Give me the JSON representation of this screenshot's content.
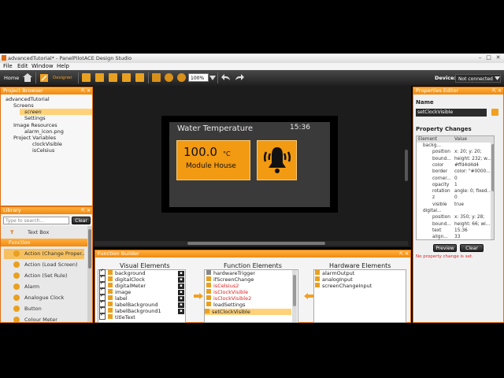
{
  "window": {
    "title": "advancedTutorial* - PanelPilotACE Design Studio"
  },
  "menu": {
    "file": "File",
    "edit": "Edit",
    "window": "Window",
    "help": "Help"
  },
  "toolbar": {
    "home": "Home",
    "designer": "Designer",
    "zoom": "100%",
    "device_label": "Device:",
    "device_value": "Not connected"
  },
  "project_browser": {
    "title": "Project Browser",
    "items": [
      "advancedTutorial",
      "Screens",
      "screen",
      "Settings",
      "Image Resources",
      "alarm_icon.png",
      "Project Variables",
      "clockVisible",
      "isCelsius"
    ]
  },
  "library": {
    "title": "Library",
    "search_placeholder": "Type to search...",
    "clear": "Clear",
    "top_item": "Text Box",
    "section": "Function",
    "items": [
      "Action (Change Proper...",
      "Action (Load Screen)",
      "Action (Set Rule)",
      "Alarm",
      "Analogue Clock",
      "Button",
      "Colour Meter"
    ]
  },
  "canvas": {
    "title": "Water Temperature",
    "clock": "15:36",
    "value": "100.0",
    "unit": "°C",
    "label": "Module House"
  },
  "function_builder": {
    "title": "Function Builder",
    "visual_elements_title": "Visual Elements",
    "visual_elements": [
      "background",
      "digitalClock",
      "digitalMeter",
      "image",
      "label",
      "labelBackground",
      "labelBackground1",
      "titleText"
    ],
    "function_elements_title": "Function Elements",
    "function_elements": [
      "hardwareTrigger",
      "ifScreenChange",
      "isCelsius2",
      "isClockVisible",
      "isClockVisible2",
      "loadSettings",
      "setClockVisible"
    ],
    "hardware_elements_title": "Hardware Elements",
    "hardware_elements": [
      "alarmOutput",
      "analogInput",
      "screenChangeInput"
    ]
  },
  "properties": {
    "title": "Properties Editor",
    "name_label": "Name",
    "name_value": "setClockVisible",
    "changes_title": "Property Changes",
    "col_element": "Element",
    "col_value": "Value",
    "rows": [
      {
        "k": "backg...",
        "v": ""
      },
      {
        "k": "position",
        "v": "x: 20; y: 20;"
      },
      {
        "k": "bound...",
        "v": "height: 232; w..."
      },
      {
        "k": "color",
        "v": "#ffd4d4d4"
      },
      {
        "k": "border",
        "v": "color: \"#0000..."
      },
      {
        "k": "corner...",
        "v": "0"
      },
      {
        "k": "opacity",
        "v": "1"
      },
      {
        "k": "rotation",
        "v": "angle: 0; fixed..."
      },
      {
        "k": "z",
        "v": "0"
      },
      {
        "k": "visible",
        "v": "true"
      },
      {
        "k": "digital...",
        "v": ""
      },
      {
        "k": "position",
        "v": "x: 350; y: 28;"
      },
      {
        "k": "bound...",
        "v": "height: 66; wi..."
      },
      {
        "k": "text",
        "v": "15:36"
      },
      {
        "k": "align...",
        "v": "33"
      }
    ],
    "preview": "Preview",
    "clear": "Clear",
    "status": "No property change is set."
  },
  "colors": {
    "accent": "#f29a12",
    "header": "#f08a10",
    "toolbar": "#2a2a2a",
    "error": "#e02020"
  }
}
